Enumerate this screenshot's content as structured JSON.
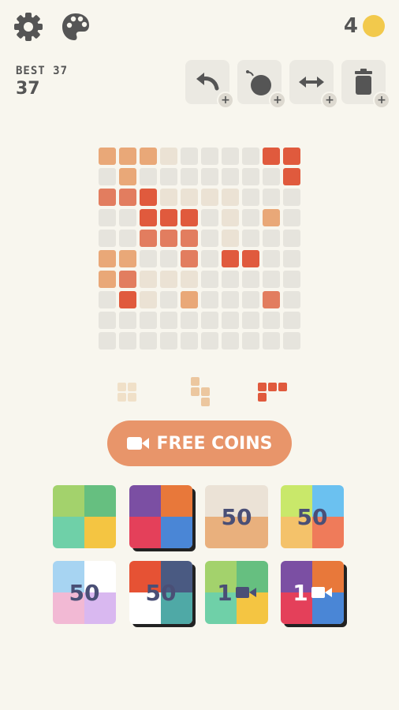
{
  "header": {
    "settings_icon": "gear-icon",
    "theme_icon": "palette-icon",
    "coins": "4",
    "best_label": "BEST 37",
    "score": "37"
  },
  "toolbar": {
    "tools": [
      {
        "name": "undo",
        "icon": "undo-icon",
        "plus": "+"
      },
      {
        "name": "bomb",
        "icon": "bomb-icon",
        "plus": "+"
      },
      {
        "name": "swap",
        "icon": "double-arrow-icon",
        "plus": "+"
      },
      {
        "name": "trash",
        "icon": "trash-icon",
        "plus": "+"
      }
    ]
  },
  "board": {
    "size": 10,
    "colors": {
      "0": "#e6e4dd",
      "1": "#ecd9c0",
      "2": "#e9a878",
      "3": "#e9a878",
      "4": "#e27d5f",
      "5": "#e05a3d",
      "6": "#ebe2d4",
      "7": "#e98d6a"
    },
    "rows": [
      [
        2,
        2,
        2,
        6,
        0,
        0,
        0,
        0,
        5,
        5
      ],
      [
        0,
        2,
        0,
        0,
        0,
        0,
        0,
        0,
        0,
        5
      ],
      [
        4,
        4,
        5,
        6,
        6,
        6,
        6,
        0,
        0,
        0
      ],
      [
        0,
        0,
        5,
        5,
        5,
        0,
        6,
        0,
        2,
        0
      ],
      [
        0,
        0,
        4,
        4,
        4,
        0,
        6,
        0,
        0,
        0
      ],
      [
        2,
        2,
        0,
        0,
        4,
        0,
        5,
        5,
        0,
        0
      ],
      [
        2,
        4,
        6,
        6,
        6,
        0,
        0,
        0,
        0,
        0
      ],
      [
        0,
        5,
        6,
        0,
        2,
        0,
        0,
        0,
        4,
        0
      ],
      [
        0,
        0,
        0,
        0,
        0,
        0,
        0,
        0,
        0,
        0
      ],
      [
        0,
        0,
        0,
        0,
        0,
        0,
        0,
        0,
        0,
        0
      ]
    ]
  },
  "pieces": [
    {
      "color": "#f0e0c8",
      "cells": [
        [
          0,
          0
        ],
        [
          1,
          0
        ],
        [
          0,
          1
        ],
        [
          1,
          1
        ]
      ]
    },
    {
      "color": "#ecc79f",
      "cells": [
        [
          0,
          0
        ],
        [
          0,
          1
        ],
        [
          1,
          1
        ],
        [
          1,
          2
        ]
      ]
    },
    {
      "color": "#e05a3d",
      "cells": [
        [
          0,
          0
        ],
        [
          1,
          0
        ],
        [
          2,
          0
        ],
        [
          0,
          1
        ]
      ]
    }
  ],
  "free_coins": {
    "label": "FREE COINS",
    "icon": "video-camera-icon"
  },
  "themes": [
    {
      "colors": [
        "#a3d26c",
        "#66bf80",
        "#6fd0a8",
        "#f4c542"
      ],
      "price": "",
      "owned": false
    },
    {
      "colors": [
        "#7b4fa3",
        "#e8783a",
        "#e4405a",
        "#4a86d6"
      ],
      "price": "",
      "owned": true
    },
    {
      "colors": [
        "#ebe2d6",
        "#ebe2d6",
        "#e9b07d",
        "#e9b07d"
      ],
      "price": "50",
      "owned": false
    },
    {
      "colors": [
        "#c9e86a",
        "#6bc1f0",
        "#f4c26a",
        "#ef7b5a"
      ],
      "price": "50",
      "owned": false
    },
    {
      "colors": [
        "#a7d4f2",
        "#ffffff",
        "#f2b9d4",
        "#d9b8f0"
      ],
      "price": "50",
      "owned": false
    },
    {
      "colors": [
        "#e65234",
        "#4a5a82",
        "#ffffff",
        "#4fa9a6"
      ],
      "price": "50",
      "owned": true
    },
    {
      "colors": [
        "#a3d26c",
        "#66bf80",
        "#6fd0a8",
        "#f4c542"
      ],
      "price": "1",
      "owned": false,
      "video": true
    },
    {
      "colors": [
        "#7b4fa3",
        "#e8783a",
        "#e4405a",
        "#4a86d6"
      ],
      "price": "1",
      "owned": true,
      "video": true,
      "light": true
    }
  ]
}
